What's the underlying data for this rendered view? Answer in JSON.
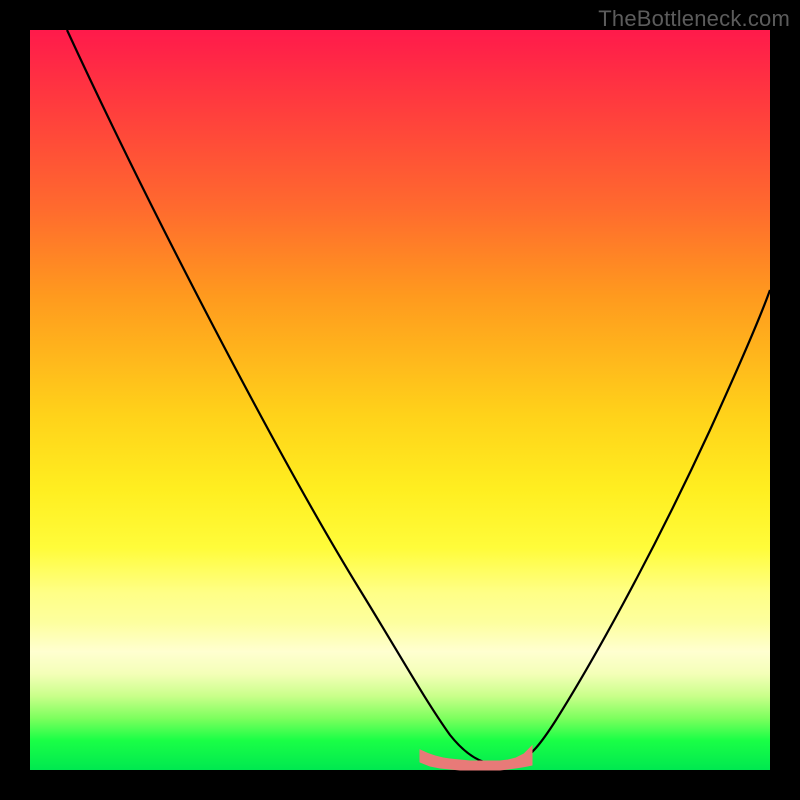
{
  "watermark": "TheBottleneck.com",
  "chart_data": {
    "type": "line",
    "title": "",
    "xlabel": "",
    "ylabel": "",
    "xlim": [
      0,
      100
    ],
    "ylim": [
      0,
      100
    ],
    "series": [
      {
        "name": "left-curve",
        "x": [
          5,
          10,
          15,
          20,
          25,
          30,
          35,
          40,
          45,
          50,
          52,
          54,
          55,
          56,
          58,
          60,
          62,
          64
        ],
        "y": [
          100,
          90,
          80,
          70,
          60,
          50,
          40,
          31,
          22,
          13,
          10,
          7,
          5,
          4,
          2.2,
          1.4,
          1,
          0.8
        ]
      },
      {
        "name": "right-curve",
        "x": [
          64,
          66,
          68,
          70,
          72,
          74,
          76,
          80,
          84,
          88,
          92,
          96,
          100
        ],
        "y": [
          0.8,
          1,
          1.5,
          2.5,
          5,
          9,
          14,
          24,
          34,
          43,
          52,
          60,
          67
        ]
      },
      {
        "name": "bottom-band",
        "x": [
          52,
          54,
          56,
          58,
          60,
          62,
          64,
          65,
          66,
          67,
          68,
          69
        ],
        "y": [
          1.6,
          1.2,
          1,
          0.9,
          0.8,
          0.8,
          0.8,
          0.9,
          1.1,
          1.5,
          2.2,
          3.2
        ]
      }
    ],
    "gradient_stops": [
      {
        "pos": 0,
        "color": "#ff1a4b"
      },
      {
        "pos": 50,
        "color": "#ffd21a"
      },
      {
        "pos": 80,
        "color": "#ffff9e"
      },
      {
        "pos": 100,
        "color": "#00e850"
      }
    ]
  }
}
